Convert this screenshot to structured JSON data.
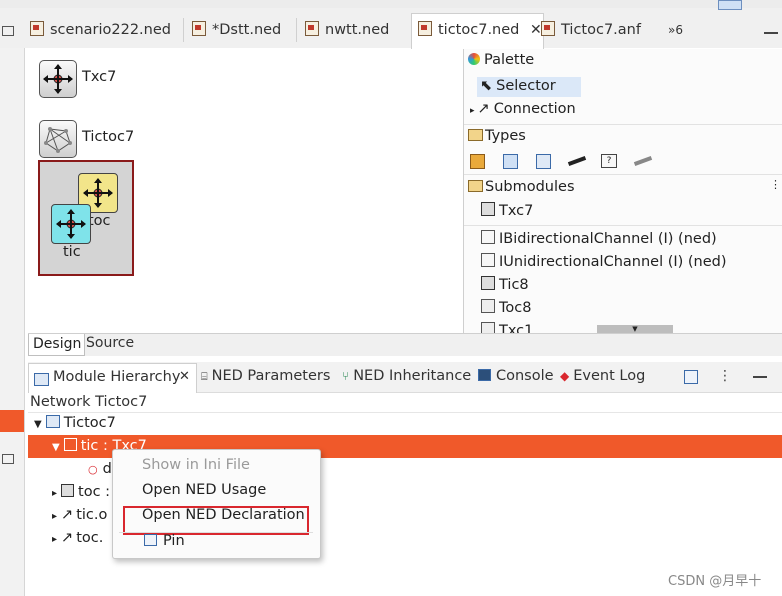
{
  "editor_tabs": [
    {
      "label": "scenario222.ned"
    },
    {
      "label": "*Dstt.ned"
    },
    {
      "label": "nwtt.ned"
    },
    {
      "label": "tictoc7.ned",
      "active": true
    },
    {
      "label": "Tictoc7.anf"
    },
    {
      "label": "»6"
    }
  ],
  "canvas": {
    "items": [
      {
        "label": "Txc7",
        "icon": "txc7-icon"
      },
      {
        "label": "Tictoc7",
        "icon": "network-icon"
      }
    ],
    "submodules": [
      {
        "label": "toc",
        "color": "#f2e58a"
      },
      {
        "label": "tic",
        "color": "#7fe3ea"
      }
    ]
  },
  "palette": {
    "title": "Palette",
    "selector": "Selector",
    "connection": "Connection",
    "types_header": "Types",
    "submodules_header": "Submodules",
    "submodules": [
      "Txc7",
      "IBidirectionalChannel (I) (ned)",
      "IUnidirectionalChannel (I) (ned)",
      "Tic8",
      "Toc8",
      "Txc1"
    ]
  },
  "editor_mode_tabs": {
    "design": "Design",
    "source": "Source"
  },
  "bottom_tabs": [
    {
      "label": "Module Hierarchy",
      "active": true
    },
    {
      "label": "NED Parameters"
    },
    {
      "label": "NED Inheritance"
    },
    {
      "label": "Console"
    },
    {
      "label": "Event Log"
    }
  ],
  "hierarchy": {
    "network_label": "Network Tictoc7",
    "root": "Tictoc7",
    "rows": [
      "tic : Txc7",
      "d",
      "toc :",
      "tic.o",
      "toc."
    ]
  },
  "context_menu": {
    "items": [
      "Show in Ini File",
      "Open NED Usage",
      "Open NED Declaration",
      "Pin"
    ]
  },
  "watermark": "CSDN @月早十",
  "colors": {
    "selection": "#f0592a",
    "highlight_box": "#d9272e",
    "accent": "#3b7dd8"
  }
}
